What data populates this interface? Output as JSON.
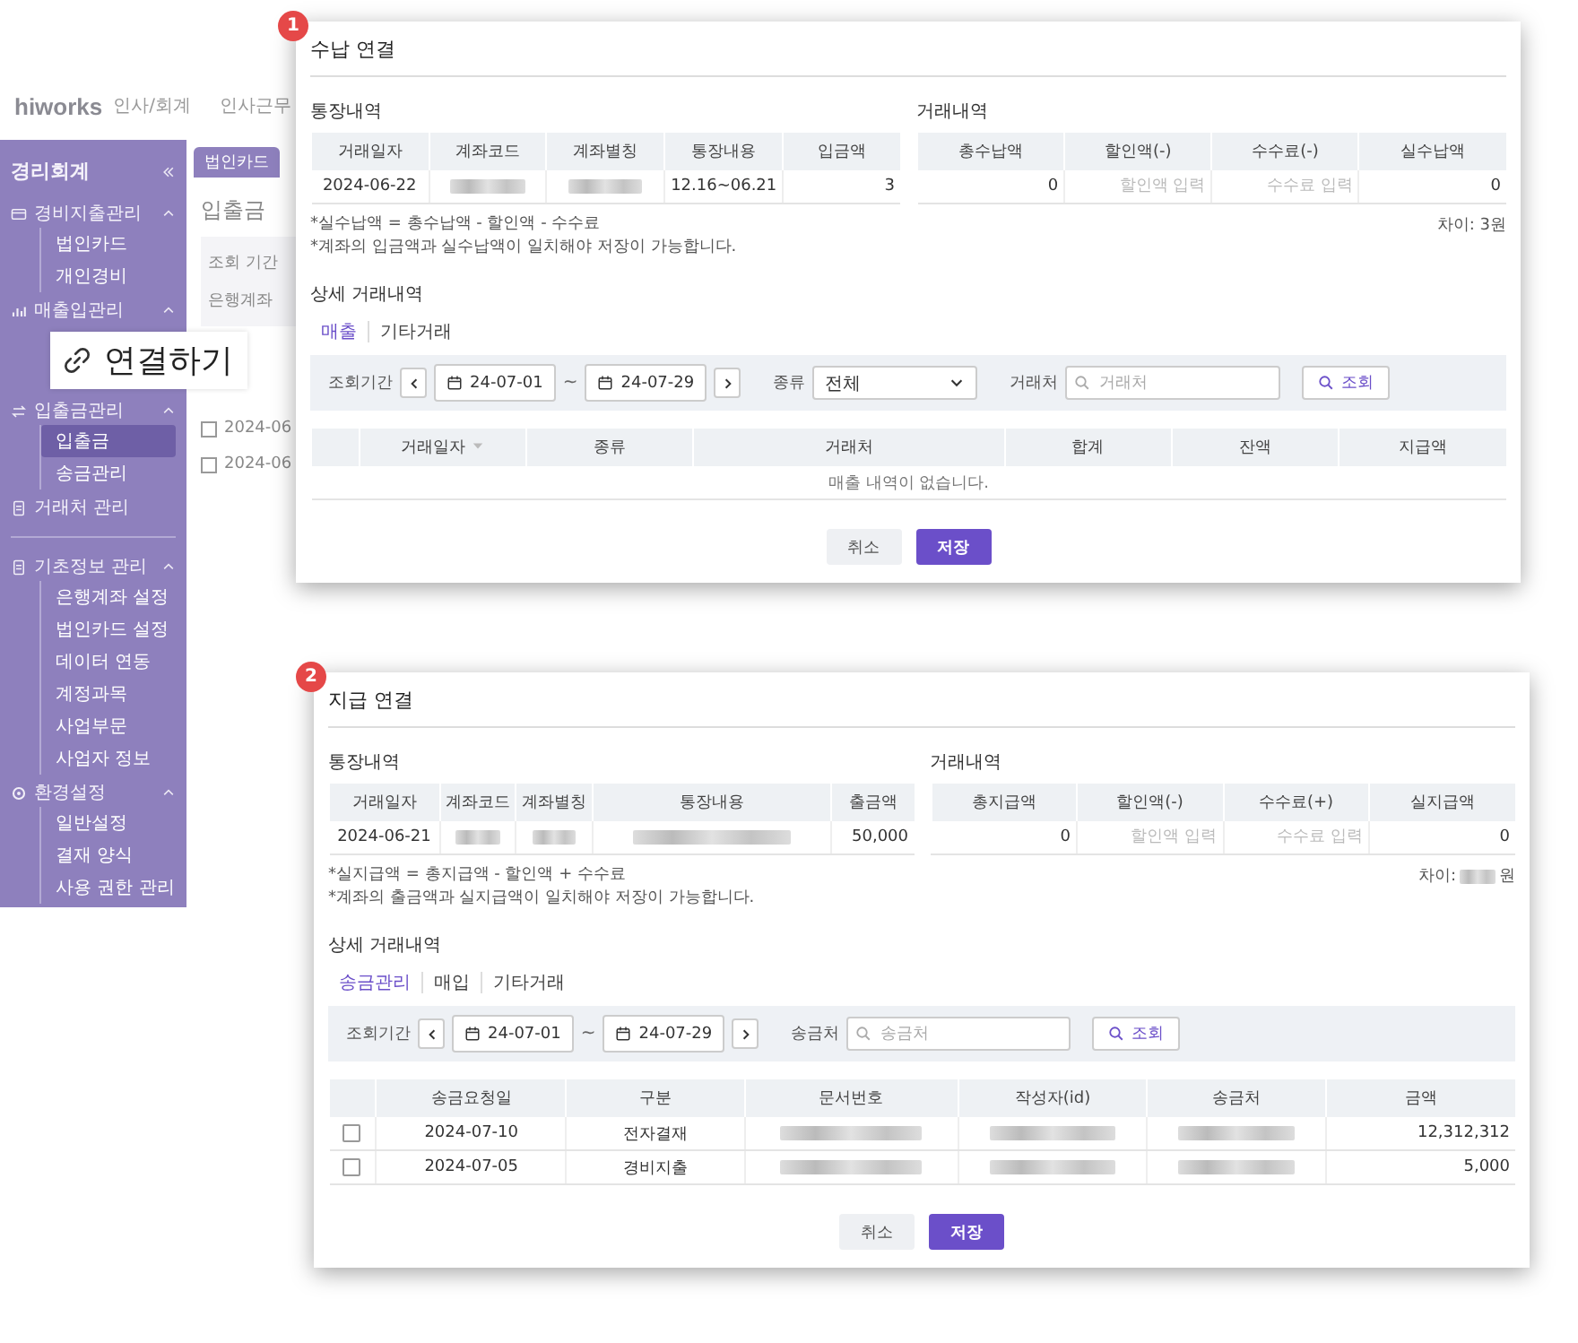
{
  "app": {
    "logo": "hiworks",
    "product": "인사/회계",
    "nav": [
      "인사근무"
    ],
    "tabs": [
      {
        "label": "법인카드",
        "selected": false
      }
    ],
    "page_title": "입출금",
    "filter_labels": [
      "조회 기간",
      "은행계좌"
    ],
    "rows": [
      {
        "checked": false,
        "date": "2024-06"
      },
      {
        "checked": false,
        "date": "2024-06"
      }
    ]
  },
  "sidebar": {
    "title": "경리회계",
    "sections": [
      {
        "label": "경비지출관리",
        "expanded": true,
        "children": [
          {
            "label": "법인카드",
            "selected": false
          },
          {
            "label": "개인경비",
            "selected": false
          }
        ]
      },
      {
        "label": "매출입관리",
        "expanded": true,
        "callout": {
          "text": "연결하기"
        }
      },
      {
        "label": "입출금관리",
        "expanded": true,
        "children": [
          {
            "label": "입출금",
            "selected": true
          },
          {
            "label": "송금관리",
            "selected": false
          }
        ]
      },
      {
        "label": "거래처 관리",
        "divider_after": true
      },
      {
        "label": "기초정보 관리",
        "expanded": true,
        "children": [
          {
            "label": "은행계좌 설정",
            "selected": false
          },
          {
            "label": "법인카드 설정",
            "selected": false
          },
          {
            "label": "데이터 연동",
            "selected": false
          },
          {
            "label": "계정과목",
            "selected": false
          },
          {
            "label": "사업부문",
            "selected": false
          },
          {
            "label": "사업자 정보",
            "selected": false
          }
        ]
      },
      {
        "label": "환경설정",
        "expanded": true,
        "children": [
          {
            "label": "일반설정",
            "selected": false
          },
          {
            "label": "결재 양식",
            "selected": false
          },
          {
            "label": "사용 권한 관리",
            "selected": false
          }
        ]
      }
    ]
  },
  "dialogs": [
    {
      "badge": "1",
      "title": "수납 연결",
      "bank": {
        "heading": "통장내역",
        "columns": [
          "거래일자",
          "계좌코드",
          "계좌별칭",
          "통장내용",
          "입금액"
        ],
        "row": [
          "2024-06-22",
          {
            "kind": "blurred"
          },
          {
            "kind": "blurred"
          },
          "12.16~06.21",
          "3"
        ]
      },
      "txn": {
        "heading": "거래내역",
        "columns": [
          "총수납액",
          "할인액(-)",
          "수수료(-)",
          "실수납액"
        ],
        "row": [
          "0",
          {
            "kind": "input",
            "placeholder": "할인액 입력"
          },
          {
            "kind": "input",
            "placeholder": "수수료 입력"
          },
          "0"
        ]
      },
      "notes": [
        "*실수납액 = 총수납액 - 할인액 - 수수료",
        "*계좌의 입금액과 실수납액이 일치해야 저장이 가능합니다."
      ],
      "diff": [
        "차이: 3원"
      ],
      "detail": {
        "heading": "상세 거래내역",
        "tabs": [
          {
            "label": "매출",
            "selected": true
          },
          {
            "label": "기타거래",
            "selected": false
          }
        ],
        "filter": [
          {
            "kind": "label",
            "text": "조회기간"
          },
          {
            "kind": "prev"
          },
          {
            "kind": "date",
            "value": "24-07-01"
          },
          {
            "kind": "sep",
            "text": "~"
          },
          {
            "kind": "date",
            "value": "24-07-29"
          },
          {
            "kind": "next"
          },
          {
            "kind": "label",
            "text": "종류"
          },
          {
            "kind": "select",
            "value": "전체"
          },
          {
            "kind": "label",
            "text": "거래처"
          },
          {
            "kind": "search",
            "placeholder": "거래처"
          },
          {
            "kind": "button",
            "text": "조회"
          }
        ],
        "columns": [
          {
            "label": "거래일자",
            "sorted": true
          },
          {
            "label": "종류",
            "sorted": false
          },
          {
            "label": "거래처",
            "sorted": false
          },
          {
            "label": "합계",
            "sorted": false
          },
          {
            "label": "잔액",
            "sorted": false
          },
          {
            "label": "지급액",
            "sorted": false
          }
        ],
        "empty": "매출 내역이 없습니다."
      },
      "buttons": [
        {
          "label": "취소",
          "kind": "secondary"
        },
        {
          "label": "저장",
          "kind": "primary"
        }
      ]
    },
    {
      "badge": "2",
      "title": "지급 연결",
      "bank": {
        "heading": "통장내역",
        "columns": [
          "거래일자",
          "계좌코드",
          "계좌별칭",
          "통장내용",
          "출금액"
        ],
        "row": [
          "2024-06-21",
          {
            "kind": "blurred"
          },
          {
            "kind": "blurred"
          },
          {
            "kind": "blurred"
          },
          "50,000"
        ]
      },
      "txn": {
        "heading": "거래내역",
        "columns": [
          "총지급액",
          "할인액(-)",
          "수수료(+)",
          "실지급액"
        ],
        "row": [
          "0",
          {
            "kind": "input",
            "placeholder": "할인액 입력"
          },
          {
            "kind": "input",
            "placeholder": "수수료 입력"
          },
          "0"
        ]
      },
      "notes": [
        "*실지급액 = 총지급액 - 할인액 + 수수료",
        "*계좌의 출금액과 실지급액이 일치해야 저장이 가능합니다."
      ],
      "diff": [
        "차이:",
        {
          "kind": "blurred"
        },
        "원"
      ],
      "detail": {
        "heading": "상세 거래내역",
        "tabs": [
          {
            "label": "송금관리",
            "selected": true
          },
          {
            "label": "매입",
            "selected": false
          },
          {
            "label": "기타거래",
            "selected": false
          }
        ],
        "filter": [
          {
            "kind": "label",
            "text": "조회기간"
          },
          {
            "kind": "prev"
          },
          {
            "kind": "date",
            "value": "24-07-01"
          },
          {
            "kind": "sep",
            "text": "~"
          },
          {
            "kind": "date",
            "value": "24-07-29"
          },
          {
            "kind": "next"
          },
          {
            "kind": "label",
            "text": "송금처"
          },
          {
            "kind": "search",
            "placeholder": "송금처"
          },
          {
            "kind": "button",
            "text": "조회"
          }
        ],
        "columns": [
          {
            "label": "송금요청일",
            "sorted": false
          },
          {
            "label": "구분",
            "sorted": false
          },
          {
            "label": "문서번호",
            "sorted": false
          },
          {
            "label": "작성자(id)",
            "sorted": false
          },
          {
            "label": "송금처",
            "sorted": false
          },
          {
            "label": "금액",
            "sorted": false
          }
        ],
        "rows": [
          {
            "checked": false,
            "cells": [
              "2024-07-10",
              "전자결재",
              {
                "kind": "blurred"
              },
              {
                "kind": "blurred"
              },
              {
                "kind": "blurred"
              },
              "12,312,312"
            ]
          },
          {
            "checked": false,
            "cells": [
              "2024-07-05",
              "경비지출",
              {
                "kind": "blurred"
              },
              {
                "kind": "blurred"
              },
              {
                "kind": "blurred"
              },
              "5,000"
            ]
          }
        ]
      },
      "buttons": [
        {
          "label": "취소",
          "kind": "secondary"
        },
        {
          "label": "저장",
          "kind": "primary"
        }
      ]
    }
  ]
}
